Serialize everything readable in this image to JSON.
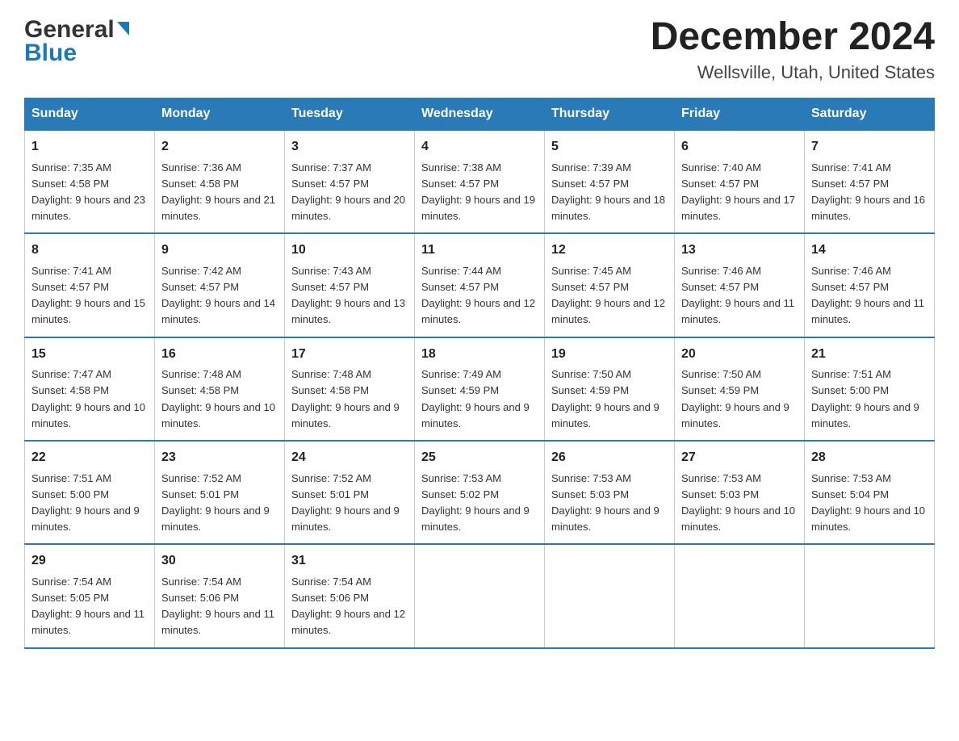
{
  "logo": {
    "general": "General",
    "blue": "Blue"
  },
  "title": "December 2024",
  "subtitle": "Wellsville, Utah, United States",
  "days_of_week": [
    "Sunday",
    "Monday",
    "Tuesday",
    "Wednesday",
    "Thursday",
    "Friday",
    "Saturday"
  ],
  "weeks": [
    [
      {
        "day": "1",
        "sunrise": "7:35 AM",
        "sunset": "4:58 PM",
        "daylight": "9 hours and 23 minutes."
      },
      {
        "day": "2",
        "sunrise": "7:36 AM",
        "sunset": "4:58 PM",
        "daylight": "9 hours and 21 minutes."
      },
      {
        "day": "3",
        "sunrise": "7:37 AM",
        "sunset": "4:57 PM",
        "daylight": "9 hours and 20 minutes."
      },
      {
        "day": "4",
        "sunrise": "7:38 AM",
        "sunset": "4:57 PM",
        "daylight": "9 hours and 19 minutes."
      },
      {
        "day": "5",
        "sunrise": "7:39 AM",
        "sunset": "4:57 PM",
        "daylight": "9 hours and 18 minutes."
      },
      {
        "day": "6",
        "sunrise": "7:40 AM",
        "sunset": "4:57 PM",
        "daylight": "9 hours and 17 minutes."
      },
      {
        "day": "7",
        "sunrise": "7:41 AM",
        "sunset": "4:57 PM",
        "daylight": "9 hours and 16 minutes."
      }
    ],
    [
      {
        "day": "8",
        "sunrise": "7:41 AM",
        "sunset": "4:57 PM",
        "daylight": "9 hours and 15 minutes."
      },
      {
        "day": "9",
        "sunrise": "7:42 AM",
        "sunset": "4:57 PM",
        "daylight": "9 hours and 14 minutes."
      },
      {
        "day": "10",
        "sunrise": "7:43 AM",
        "sunset": "4:57 PM",
        "daylight": "9 hours and 13 minutes."
      },
      {
        "day": "11",
        "sunrise": "7:44 AM",
        "sunset": "4:57 PM",
        "daylight": "9 hours and 12 minutes."
      },
      {
        "day": "12",
        "sunrise": "7:45 AM",
        "sunset": "4:57 PM",
        "daylight": "9 hours and 12 minutes."
      },
      {
        "day": "13",
        "sunrise": "7:46 AM",
        "sunset": "4:57 PM",
        "daylight": "9 hours and 11 minutes."
      },
      {
        "day": "14",
        "sunrise": "7:46 AM",
        "sunset": "4:57 PM",
        "daylight": "9 hours and 11 minutes."
      }
    ],
    [
      {
        "day": "15",
        "sunrise": "7:47 AM",
        "sunset": "4:58 PM",
        "daylight": "9 hours and 10 minutes."
      },
      {
        "day": "16",
        "sunrise": "7:48 AM",
        "sunset": "4:58 PM",
        "daylight": "9 hours and 10 minutes."
      },
      {
        "day": "17",
        "sunrise": "7:48 AM",
        "sunset": "4:58 PM",
        "daylight": "9 hours and 9 minutes."
      },
      {
        "day": "18",
        "sunrise": "7:49 AM",
        "sunset": "4:59 PM",
        "daylight": "9 hours and 9 minutes."
      },
      {
        "day": "19",
        "sunrise": "7:50 AM",
        "sunset": "4:59 PM",
        "daylight": "9 hours and 9 minutes."
      },
      {
        "day": "20",
        "sunrise": "7:50 AM",
        "sunset": "4:59 PM",
        "daylight": "9 hours and 9 minutes."
      },
      {
        "day": "21",
        "sunrise": "7:51 AM",
        "sunset": "5:00 PM",
        "daylight": "9 hours and 9 minutes."
      }
    ],
    [
      {
        "day": "22",
        "sunrise": "7:51 AM",
        "sunset": "5:00 PM",
        "daylight": "9 hours and 9 minutes."
      },
      {
        "day": "23",
        "sunrise": "7:52 AM",
        "sunset": "5:01 PM",
        "daylight": "9 hours and 9 minutes."
      },
      {
        "day": "24",
        "sunrise": "7:52 AM",
        "sunset": "5:01 PM",
        "daylight": "9 hours and 9 minutes."
      },
      {
        "day": "25",
        "sunrise": "7:53 AM",
        "sunset": "5:02 PM",
        "daylight": "9 hours and 9 minutes."
      },
      {
        "day": "26",
        "sunrise": "7:53 AM",
        "sunset": "5:03 PM",
        "daylight": "9 hours and 9 minutes."
      },
      {
        "day": "27",
        "sunrise": "7:53 AM",
        "sunset": "5:03 PM",
        "daylight": "9 hours and 10 minutes."
      },
      {
        "day": "28",
        "sunrise": "7:53 AM",
        "sunset": "5:04 PM",
        "daylight": "9 hours and 10 minutes."
      }
    ],
    [
      {
        "day": "29",
        "sunrise": "7:54 AM",
        "sunset": "5:05 PM",
        "daylight": "9 hours and 11 minutes."
      },
      {
        "day": "30",
        "sunrise": "7:54 AM",
        "sunset": "5:06 PM",
        "daylight": "9 hours and 11 minutes."
      },
      {
        "day": "31",
        "sunrise": "7:54 AM",
        "sunset": "5:06 PM",
        "daylight": "9 hours and 12 minutes."
      },
      null,
      null,
      null,
      null
    ]
  ],
  "labels": {
    "sunrise": "Sunrise:",
    "sunset": "Sunset:",
    "daylight": "Daylight:"
  },
  "colors": {
    "header_bg": "#2a7ab8",
    "header_text": "#ffffff",
    "border": "#2a7ab8"
  }
}
